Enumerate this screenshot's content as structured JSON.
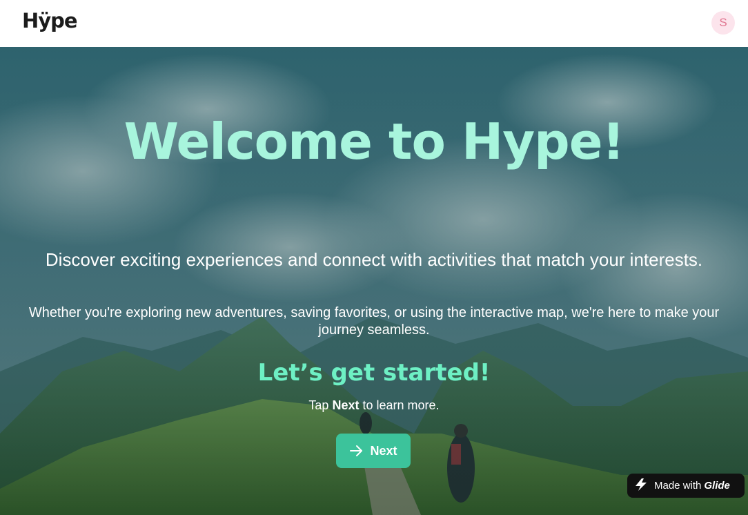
{
  "header": {
    "logo_text": "Hÿpe",
    "avatar_initial": "S"
  },
  "hero": {
    "title": "Welcome to Hype!",
    "subtitle": "Discover exciting experiences and connect with activities that match your interests.",
    "body": "Whether you're exploring new adventures, saving favorites, or using the interactive map, we're here to make your journey seamless.",
    "cta_heading": "Let’s get started!",
    "hint_prefix": "Tap",
    "hint_bold": "Next",
    "hint_suffix": "to learn more.",
    "next_button_label": "Next",
    "next_button_icon": "arrow-right-icon"
  },
  "badge": {
    "made_with": "Made with",
    "brand": "Glide",
    "icon": "glide-bolt-icon"
  },
  "colors": {
    "title": "#a8f5dd",
    "cta_heading": "#6ef0c4",
    "next_button": "#3cc39b",
    "avatar_bg": "#fce4ec",
    "avatar_text": "#e0748f",
    "badge_bg": "#111111"
  }
}
